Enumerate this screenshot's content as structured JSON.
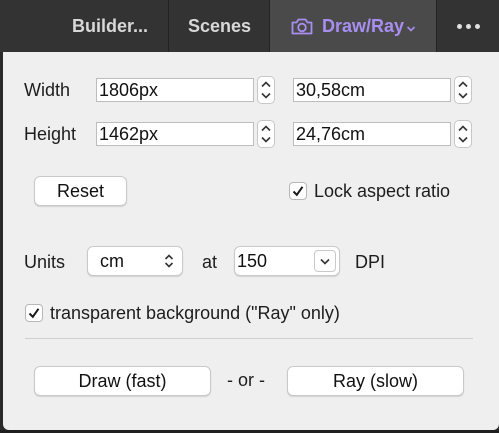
{
  "tabs": {
    "builder": "Builder...",
    "scenes": "Scenes",
    "draw": "Draw/Ray"
  },
  "accent_color": "#a88ef0",
  "icons": {
    "draw_tab": "camera-icon",
    "draw_dropdown": "chevron-down-icon",
    "more": "more-dots-icon"
  },
  "size": {
    "width_label": "Width",
    "height_label": "Height",
    "width_px": "1806px",
    "width_cm": "30,58cm",
    "height_px": "1462px",
    "height_cm": "24,76cm"
  },
  "reset_label": "Reset",
  "lock_aspect": {
    "label": "Lock aspect ratio",
    "checked": true
  },
  "units": {
    "label": "Units",
    "value": "cm",
    "at_label": "at",
    "dpi_value": "150",
    "dpi_label": "DPI"
  },
  "transparent": {
    "label": "transparent background (\"Ray\" only)",
    "checked": true
  },
  "actions": {
    "draw_label": "Draw (fast)",
    "or_label": "- or -",
    "ray_label": "Ray (slow)"
  }
}
